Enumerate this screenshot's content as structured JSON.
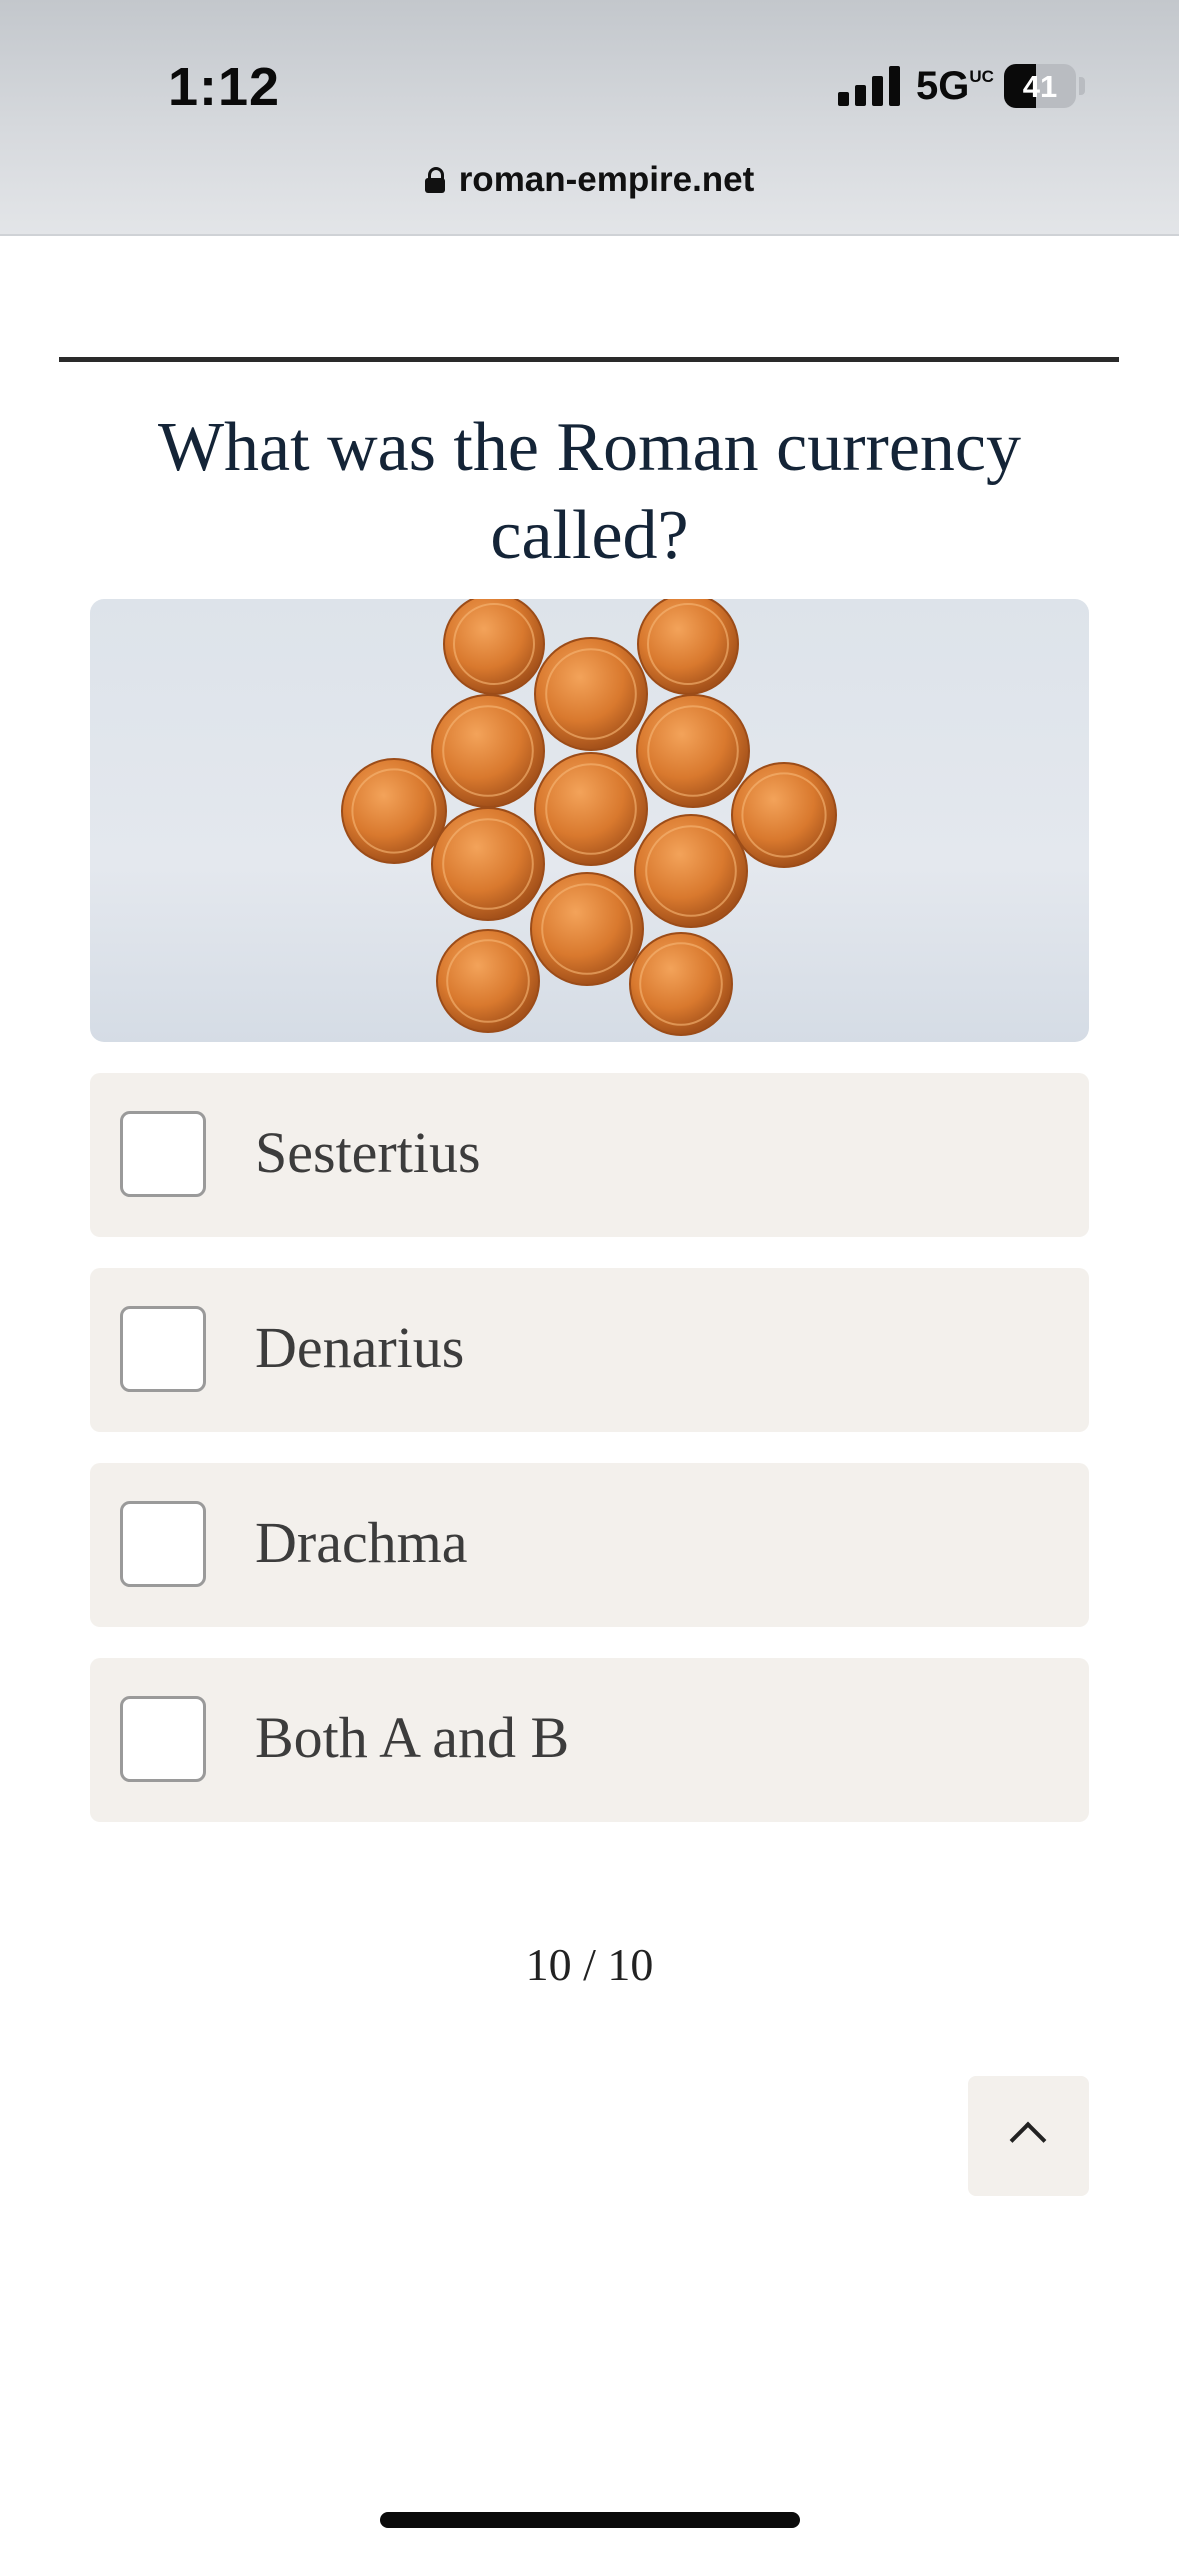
{
  "status_bar": {
    "time": "1:12",
    "network": "5G",
    "network_badge": "UC",
    "battery": "41",
    "battery_level": 0.41
  },
  "browser": {
    "url": "roman-empire.net"
  },
  "quiz": {
    "question": "What was the Roman currency called?",
    "image_icon": "coins-photo",
    "options": [
      {
        "label": "Sestertius",
        "checked": false
      },
      {
        "label": "Denarius",
        "checked": false
      },
      {
        "label": "Drachma",
        "checked": false
      },
      {
        "label": "Both A and B",
        "checked": false
      }
    ],
    "progress": "10 / 10"
  },
  "controls": {
    "scroll_top_icon": "chevron-up-icon"
  },
  "colors": {
    "question_text": "#142437",
    "option_bg": "#f3f0ec",
    "coin": "#d9792e"
  }
}
